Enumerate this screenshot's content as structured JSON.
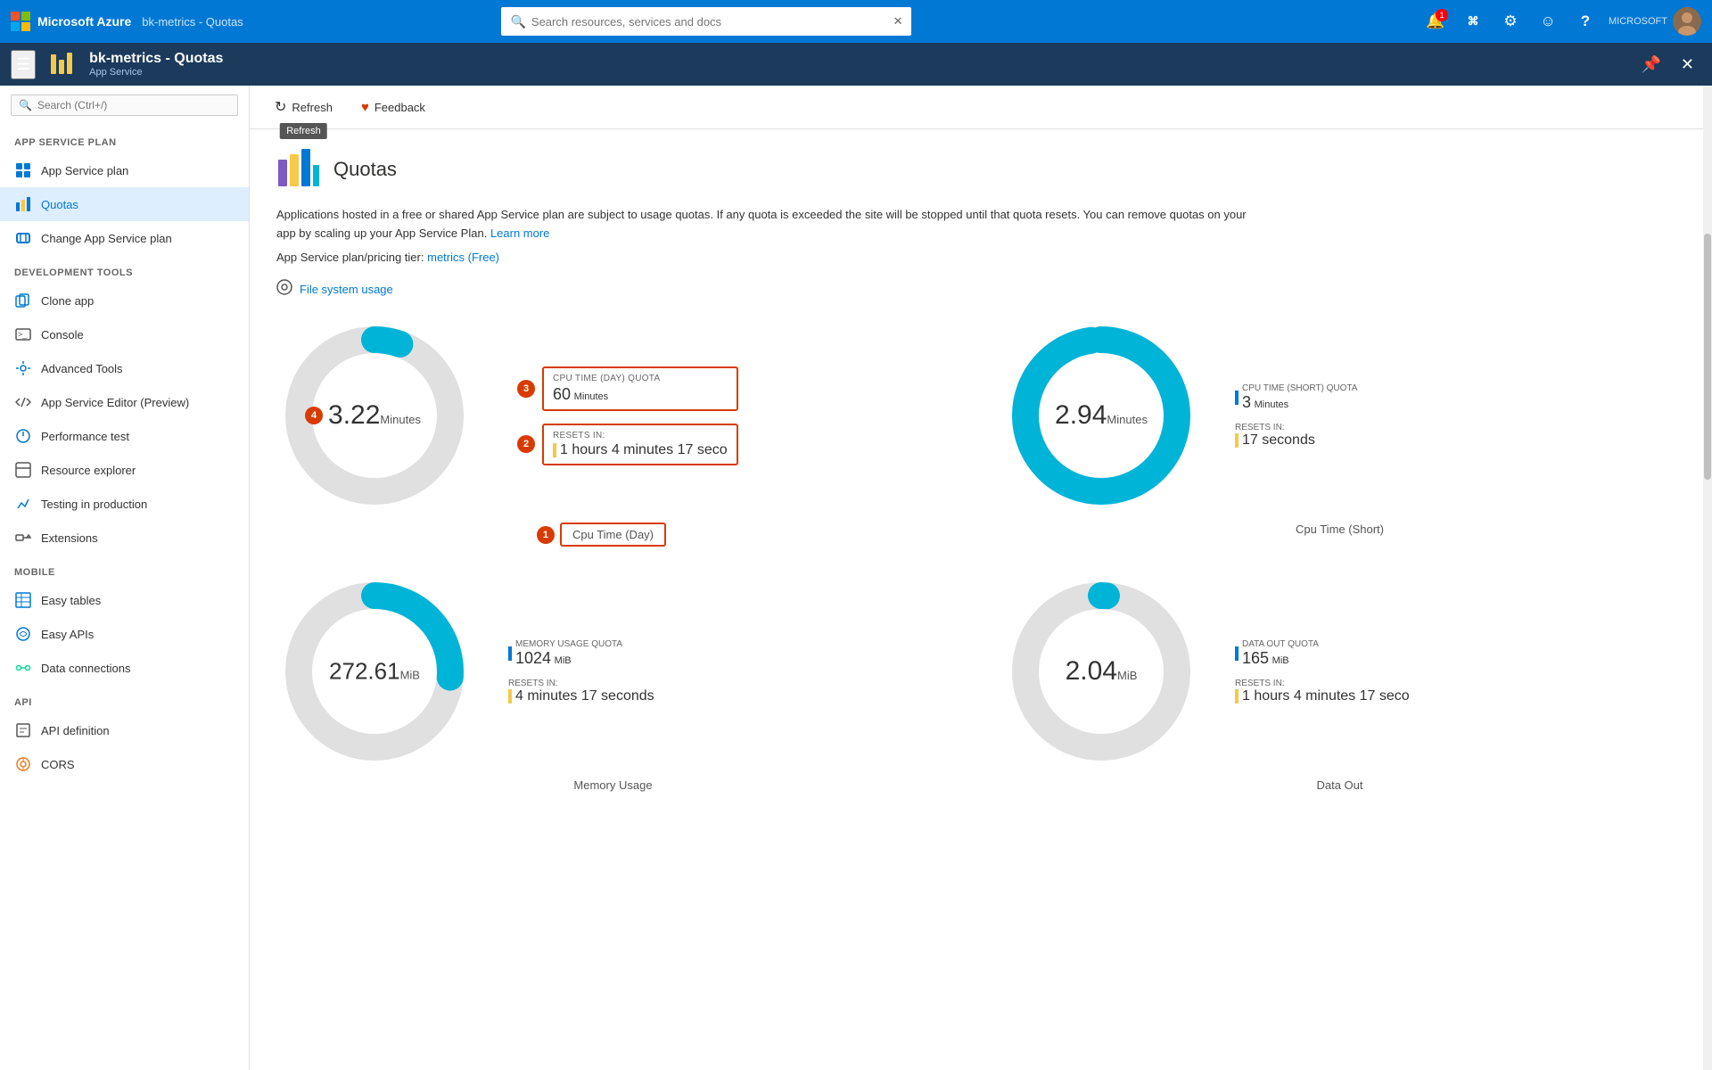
{
  "topbar": {
    "brand": "Microsoft Azure",
    "breadcrumb": "bk-metrics - Quotas",
    "search_placeholder": "Search resources, services and docs",
    "notifications_count": "1",
    "user_label": "MICROSOFT"
  },
  "secondbar": {
    "app_name": "bk-metrics - Quotas",
    "app_subtitle": "App Service"
  },
  "toolbar": {
    "refresh_label": "Refresh",
    "feedback_label": "Feedback",
    "refresh_tooltip": "Refresh"
  },
  "sidebar": {
    "search_placeholder": "Search (Ctrl+/)",
    "sections": [
      {
        "label": "APP SERVICE PLAN",
        "items": [
          {
            "id": "app-service-plan",
            "label": "App Service plan",
            "icon": "grid"
          },
          {
            "id": "quotas",
            "label": "Quotas",
            "icon": "chart",
            "active": true
          },
          {
            "id": "change-app-service-plan",
            "label": "Change App Service plan",
            "icon": "scale"
          }
        ]
      },
      {
        "label": "DEVELOPMENT TOOLS",
        "items": [
          {
            "id": "clone-app",
            "label": "Clone app",
            "icon": "clone"
          },
          {
            "id": "console",
            "label": "Console",
            "icon": "console"
          },
          {
            "id": "advanced-tools",
            "label": "Advanced Tools",
            "icon": "tools"
          },
          {
            "id": "app-service-editor",
            "label": "App Service Editor (Preview)",
            "icon": "code"
          },
          {
            "id": "performance-test",
            "label": "Performance test",
            "icon": "cloud"
          },
          {
            "id": "resource-explorer",
            "label": "Resource explorer",
            "icon": "resource"
          },
          {
            "id": "testing-in-production",
            "label": "Testing in production",
            "icon": "test"
          },
          {
            "id": "extensions",
            "label": "Extensions",
            "icon": "ext"
          }
        ]
      },
      {
        "label": "MOBILE",
        "items": [
          {
            "id": "easy-tables",
            "label": "Easy tables",
            "icon": "table"
          },
          {
            "id": "easy-apis",
            "label": "Easy APIs",
            "icon": "api"
          },
          {
            "id": "data-connections",
            "label": "Data connections",
            "icon": "data"
          }
        ]
      },
      {
        "label": "API",
        "items": [
          {
            "id": "api-definition",
            "label": "API definition",
            "icon": "api-def"
          },
          {
            "id": "cors",
            "label": "CORS",
            "icon": "cors"
          }
        ]
      }
    ]
  },
  "page": {
    "title": "Quotas",
    "description": "Applications hosted in a free or shared App Service plan are subject to usage quotas. If any quota is exceeded the site will be stopped until that quota resets. You can remove quotas on your app by scaling up your App Service Plan.",
    "learn_more": "Learn more",
    "plan_info": "App Service plan/pricing tier:",
    "plan_link": "metrics (Free)",
    "file_system_link": "File system usage"
  },
  "charts": [
    {
      "id": "cpu-time-day",
      "name": "Cpu Time (Day)",
      "value": "3.22",
      "unit": "Minutes",
      "percentage": 5.37,
      "color": "#00b4d8",
      "quota_label": "CPU TIME (DAY) QUOTA",
      "quota_value": "60",
      "quota_unit": "Minutes",
      "resets_label": "RESETS IN:",
      "resets_value": "1 hours 4 minutes 17 seco",
      "number_badge": "1",
      "quota_badge": "3",
      "resets_badge": "2",
      "value_badge": "4"
    },
    {
      "id": "cpu-time-short",
      "name": "Cpu Time (Short)",
      "value": "2.94",
      "unit": "Minutes",
      "percentage": 98,
      "color": "#00b4d8",
      "quota_label": "CPU TIME (SHORT) QUOTA",
      "quota_value": "3",
      "quota_unit": "Minutes",
      "resets_label": "RESETS IN:",
      "resets_value": "17 seconds",
      "number_badge": null,
      "quota_badge": null,
      "resets_badge": null,
      "value_badge": null
    },
    {
      "id": "memory-usage",
      "name": "Memory Usage",
      "value": "272.61",
      "unit": "MiB",
      "percentage": 26.6,
      "color": "#00b4d8",
      "quota_label": "MEMORY USAGE QUOTA",
      "quota_value": "1024",
      "quota_unit": "MiB",
      "resets_label": "RESETS IN:",
      "resets_value": "4 minutes 17 seconds",
      "number_badge": null,
      "quota_badge": null,
      "resets_badge": null,
      "value_badge": null
    },
    {
      "id": "data-out",
      "name": "Data Out",
      "value": "2.04",
      "unit": "MiB",
      "percentage": 1.2,
      "color": "#00b4d8",
      "quota_label": "DATA OUT QUOTA",
      "quota_value": "165",
      "quota_unit": "MiB",
      "resets_label": "RESETS IN:",
      "resets_value": "1 hours 4 minutes 17 seco",
      "number_badge": null,
      "quota_badge": null,
      "resets_badge": null,
      "value_badge": null
    }
  ],
  "icons": {
    "search": "🔍",
    "refresh": "↻",
    "feedback": "♥",
    "hamburger": "☰",
    "pin": "📌",
    "close": "✕",
    "bell": "🔔",
    "terminal": ">_",
    "settings": "⚙",
    "smiley": "☺",
    "help": "?",
    "chevron_right": "›",
    "file": "📄",
    "bar_chart": "📊"
  }
}
